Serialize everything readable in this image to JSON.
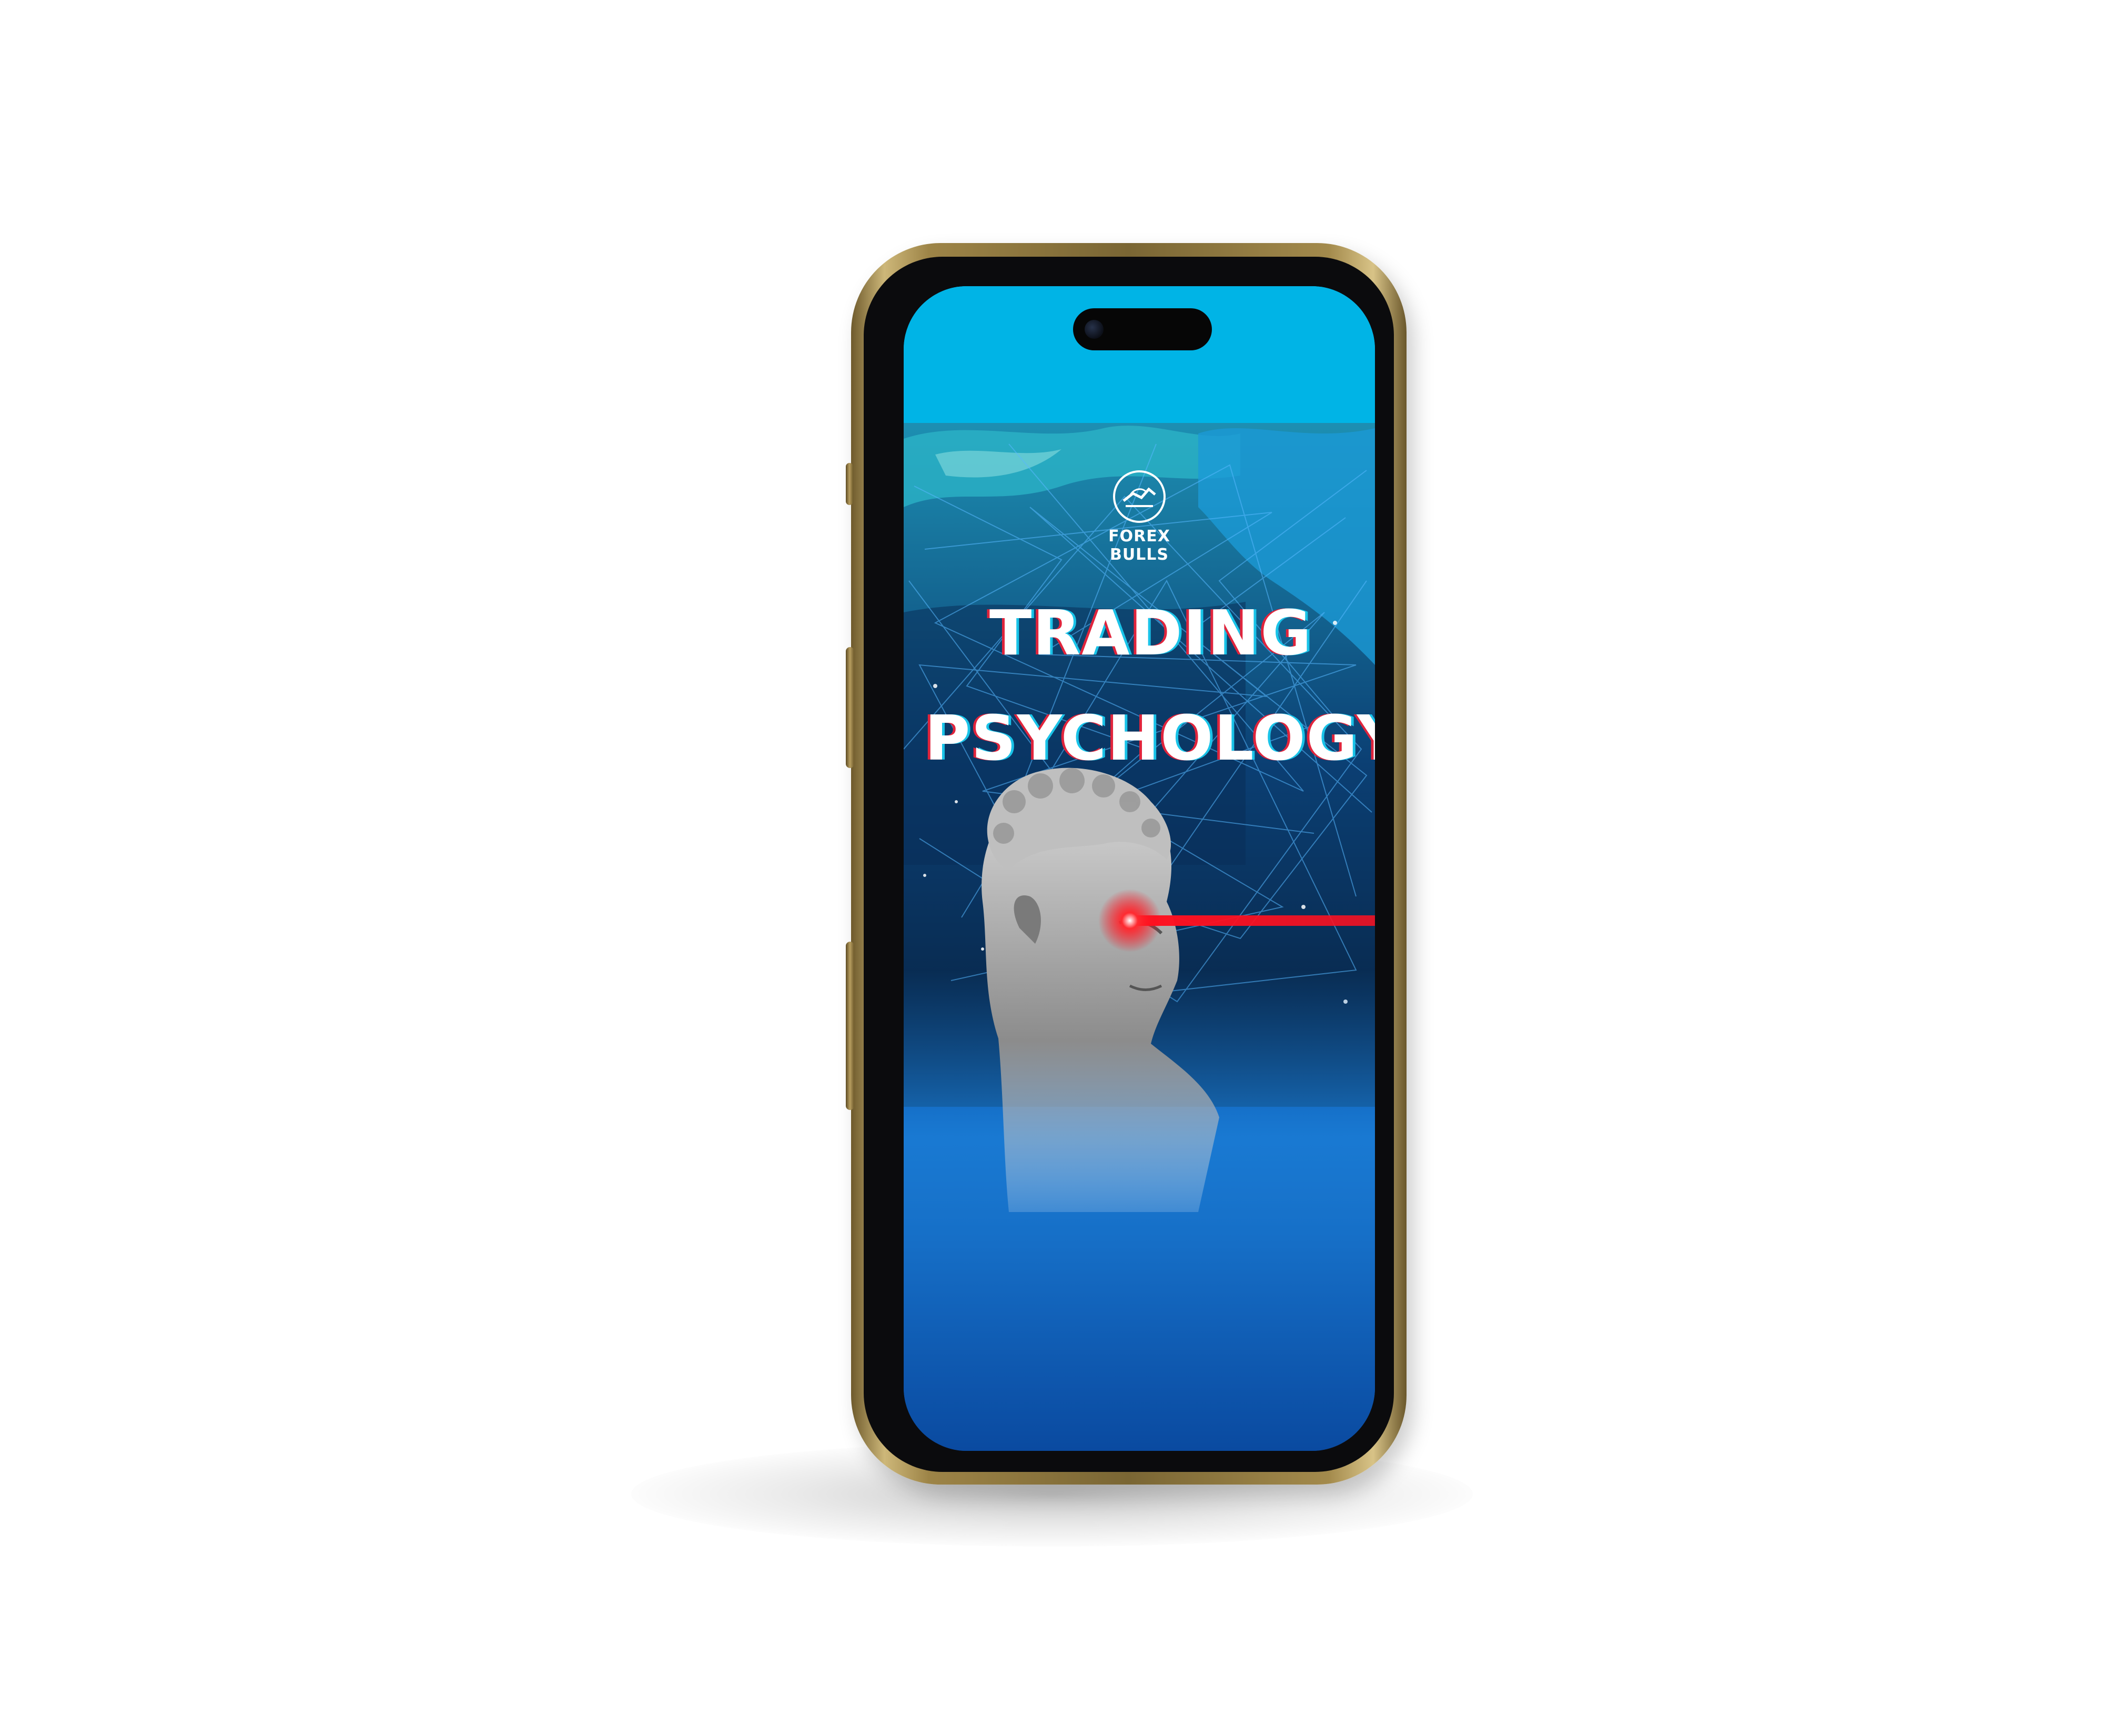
{
  "product": {
    "brand": "FOREX BULLS",
    "title_line1": "TRADING",
    "title_line2": "PSYCHOLOGY"
  },
  "scene": {
    "object": "gold-smartphone-mockup",
    "background_color": "#ffffff",
    "frame_color": "#a38a4c",
    "screen_top_color": "#00b4e6",
    "screen_bottom_color": "#0b49a0",
    "laser_color": "#ff1020",
    "icons": [
      "bull-bear-logo-icon",
      "camera-icon",
      "statue-bust-icon",
      "laser-beam-icon"
    ]
  }
}
